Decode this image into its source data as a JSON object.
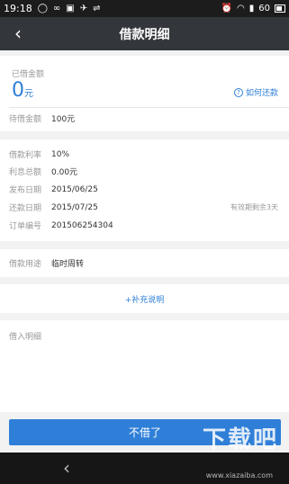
{
  "status_bar": {
    "time": "19:18",
    "battery": "60",
    "icons": [
      "chat-icon",
      "cloud-icon",
      "image-icon",
      "bluetooth-icon",
      "usb-icon",
      "alarm-icon",
      "wifi-icon",
      "signal-icon",
      "battery-icon"
    ]
  },
  "nav": {
    "title": "借款明细",
    "back_glyph": "‹"
  },
  "summary": {
    "borrowed_label": "已借金额",
    "borrowed_amount": "0",
    "borrowed_unit": "元",
    "repay_link": "如何还款",
    "pending_label": "待借金额",
    "pending_value": "100元"
  },
  "details": {
    "rate_label": "借款利率",
    "rate_value": "10%",
    "interest_label": "利息总额",
    "interest_value": "0.00元",
    "publish_label": "发布日期",
    "publish_value": "2015/06/25",
    "repay_label": "还款日期",
    "repay_value": "2015/07/25",
    "expiry_text": "有效期剩余3天",
    "order_label": "订单编号",
    "order_value": "201506254304"
  },
  "purpose": {
    "label": "借款用途",
    "value": "临时周转"
  },
  "supplement": {
    "label": "+补充说明"
  },
  "lend_detail": {
    "label": "借入明细"
  },
  "action": {
    "button_label": "不借了"
  },
  "watermark": {
    "text": "下载吧",
    "url": "www.xiazaiba.com"
  },
  "colors": {
    "accent": "#2f7fd8",
    "nav_bg": "#33363b",
    "status_bg": "#1c1c1c"
  }
}
